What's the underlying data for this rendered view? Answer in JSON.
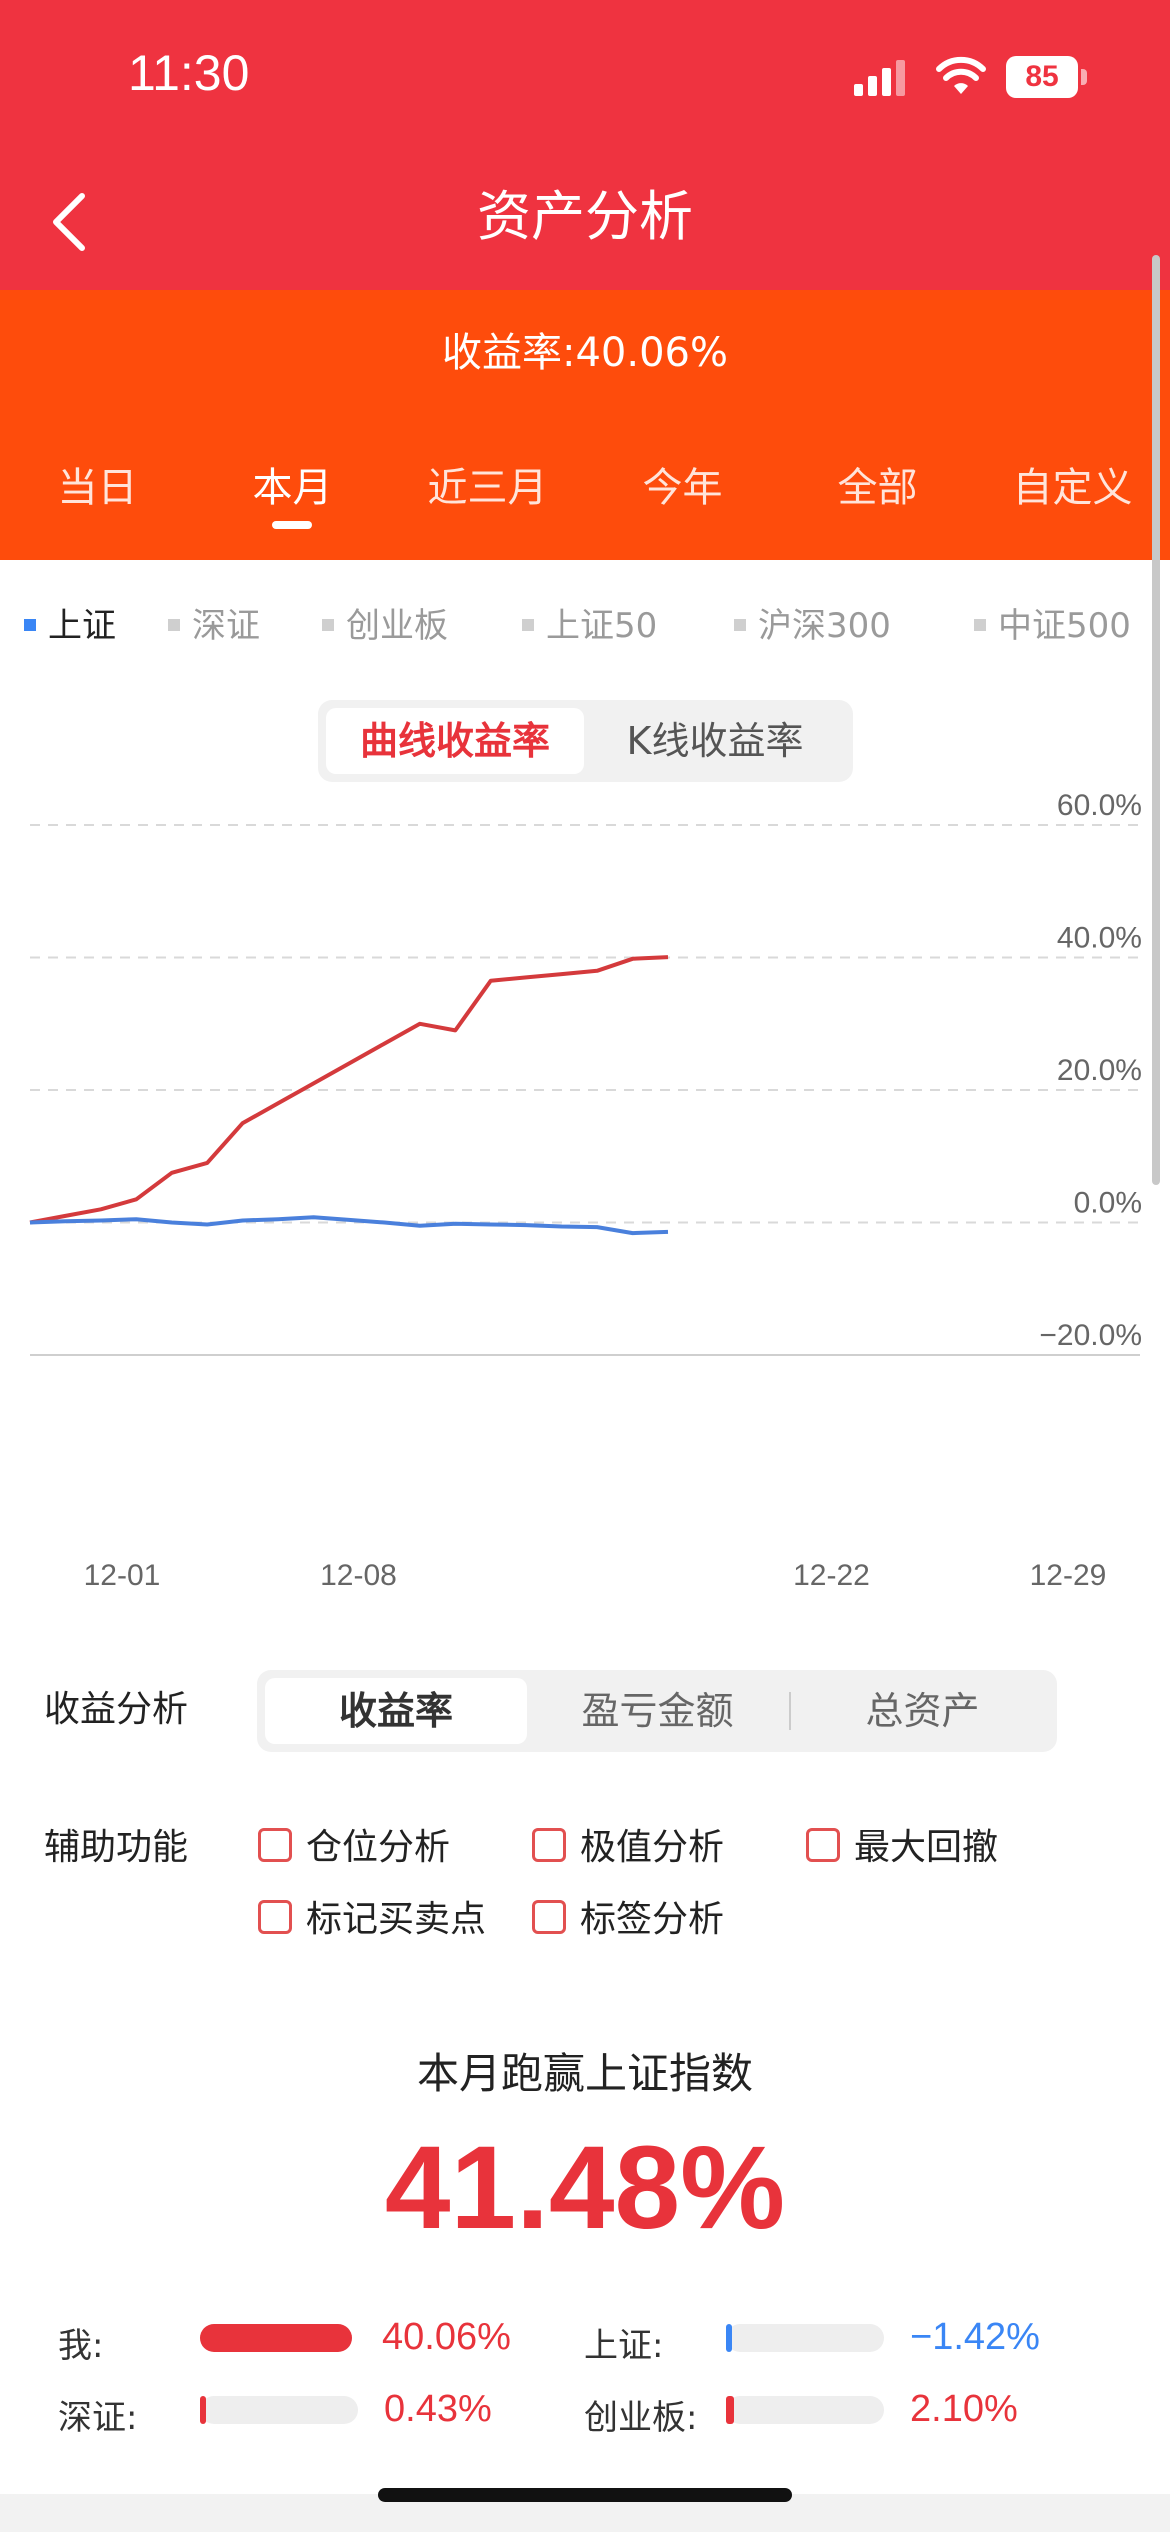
{
  "status": {
    "time": "11:30",
    "battery": "85"
  },
  "nav": {
    "title": "资产分析"
  },
  "header": {
    "rate_text": "收益率:40.06%",
    "periods": [
      "当日",
      "本月",
      "近三月",
      "今年",
      "全部",
      "自定义"
    ],
    "active_period": "本月"
  },
  "indices": [
    "上证",
    "深证",
    "创业板",
    "上证50",
    "沪深300",
    "中证500"
  ],
  "active_index": "上证",
  "chart_toggle": {
    "curve": "曲线收益率",
    "kline": "K线收益率",
    "active": "曲线收益率"
  },
  "chart_data": {
    "type": "line",
    "title": "",
    "xlabel": "",
    "ylabel": "",
    "x_ticks": [
      "12-01",
      "12-08",
      "12-22",
      "12-29"
    ],
    "y_ticks": [
      "60.0%",
      "40.0%",
      "20.0%",
      "0.0%",
      "−20.0%"
    ],
    "ylim": [
      -20,
      60
    ],
    "grid": true,
    "series": [
      {
        "color": "#d43a3c",
        "points": [
          [
            0,
            0
          ],
          [
            1,
            1
          ],
          [
            2,
            2
          ],
          [
            3,
            3.5
          ],
          [
            4,
            7.5
          ],
          [
            5,
            9
          ],
          [
            6,
            15
          ],
          [
            7,
            18
          ],
          [
            8,
            21
          ],
          [
            9,
            24
          ],
          [
            10,
            27
          ],
          [
            11,
            30
          ],
          [
            12,
            29
          ],
          [
            13,
            36.5
          ],
          [
            14,
            37
          ],
          [
            15,
            37.5
          ],
          [
            16,
            38
          ],
          [
            17,
            39.8
          ],
          [
            18,
            40.06
          ]
        ]
      },
      {
        "color": "#4a80dc",
        "points": [
          [
            0,
            0
          ],
          [
            1,
            0.2
          ],
          [
            2,
            0.3
          ],
          [
            3,
            0.5
          ],
          [
            4,
            0
          ],
          [
            5,
            -0.3
          ],
          [
            6,
            0.3
          ],
          [
            7,
            0.5
          ],
          [
            8,
            0.8
          ],
          [
            9,
            0.4
          ],
          [
            10,
            0
          ],
          [
            11,
            -0.5
          ],
          [
            12,
            -0.2
          ],
          [
            13,
            -0.3
          ],
          [
            14,
            -0.4
          ],
          [
            15,
            -0.6
          ],
          [
            16,
            -0.7
          ],
          [
            17,
            -1.6
          ],
          [
            18,
            -1.42
          ]
        ]
      }
    ]
  },
  "analysis": {
    "label": "收益分析",
    "tabs": [
      "收益率",
      "盈亏金额",
      "总资产"
    ],
    "active_tab": "收益率"
  },
  "aux": {
    "label": "辅助功能",
    "options": [
      "仓位分析",
      "极值分析",
      "最大回撤",
      "标记买卖点",
      "标签分析"
    ]
  },
  "beat": {
    "title": "本月跑赢上证指数",
    "value": "41.48%"
  },
  "compare": [
    {
      "label": "我:",
      "value": "40.06%",
      "ratio": 1.0,
      "color": "#e8333b"
    },
    {
      "label": "上证:",
      "value": "−1.42%",
      "ratio": 0.03,
      "color": "#3a86f5"
    },
    {
      "label": "深证:",
      "value": "0.43%",
      "ratio": 0.01,
      "color": "#e8333b"
    },
    {
      "label": "创业板:",
      "value": "2.10%",
      "ratio": 0.05,
      "color": "#e8333b"
    }
  ]
}
